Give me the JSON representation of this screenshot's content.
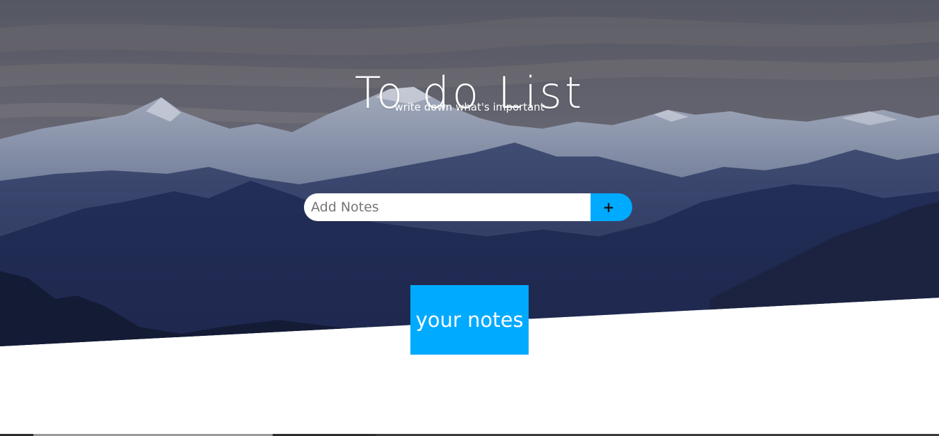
{
  "header": {
    "title": "To do List",
    "subtitle": "write down what's important"
  },
  "add_note": {
    "placeholder": "Add Notes",
    "value": "",
    "add_button_label": "+"
  },
  "notes_section": {
    "label": "your notes"
  },
  "colors": {
    "accent": "#00aaff",
    "text_light": "#ffffff"
  }
}
